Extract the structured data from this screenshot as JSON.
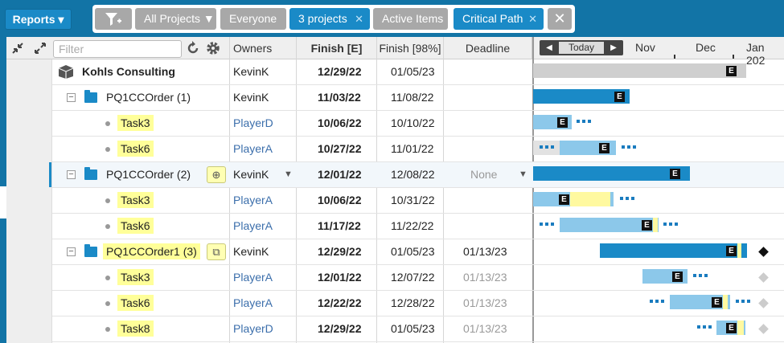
{
  "topbar": {
    "reports_label": "Reports ▾",
    "chips": {
      "all_projects": "All Projects ▼",
      "everyone": "Everyone",
      "three_projects": "3 projects",
      "active_items": "Active Items",
      "critical_path": "Critical Path",
      "close_x": "✕",
      "clear": "✕"
    }
  },
  "header": {
    "filter_placeholder": "Filter",
    "columns": {
      "owners": "Owners",
      "finish_e": "Finish [E]",
      "finish_98": "Finish [98%]",
      "deadline": "Deadline"
    },
    "gantt": {
      "prev": "◀",
      "today": "Today",
      "next": "▶",
      "months": [
        "Nov",
        "Dec",
        "Jan 202"
      ]
    }
  },
  "rows": [
    {
      "name": "Kohls Consulting",
      "owner": "KevinK",
      "finish_e": "12/29/22",
      "finish_98": "01/05/23",
      "deadline": ""
    },
    {
      "name": "PQ1CCOrder (1)",
      "owner": "KevinK",
      "finish_e": "11/03/22",
      "finish_98": "11/08/22",
      "deadline": ""
    },
    {
      "name": "Task3",
      "owner": "PlayerD",
      "finish_e": "10/06/22",
      "finish_98": "10/10/22",
      "deadline": ""
    },
    {
      "name": "Task6",
      "owner": "PlayerA",
      "finish_e": "10/27/22",
      "finish_98": "11/01/22",
      "deadline": ""
    },
    {
      "name": "PQ1CCOrder (2)",
      "owner": "KevinK",
      "finish_e": "12/01/22",
      "finish_98": "12/08/22",
      "deadline": "None"
    },
    {
      "name": "Task3",
      "owner": "PlayerA",
      "finish_e": "10/06/22",
      "finish_98": "10/31/22",
      "deadline": ""
    },
    {
      "name": "Task6",
      "owner": "PlayerA",
      "finish_e": "11/17/22",
      "finish_98": "11/22/22",
      "deadline": ""
    },
    {
      "name": "PQ1CCOrder1 (3)",
      "owner": "KevinK",
      "finish_e": "12/29/22",
      "finish_98": "01/05/23",
      "deadline": "01/13/23"
    },
    {
      "name": "Task3",
      "owner": "PlayerA",
      "finish_e": "12/01/22",
      "finish_98": "12/07/22",
      "deadline": "01/13/23"
    },
    {
      "name": "Task6",
      "owner": "PlayerA",
      "finish_e": "12/22/22",
      "finish_98": "12/28/22",
      "deadline": "01/13/23"
    },
    {
      "name": "Task8",
      "owner": "PlayerD",
      "finish_e": "12/29/22",
      "finish_98": "01/05/23",
      "deadline": "01/13/23"
    }
  ],
  "gantt_marker_label": "E",
  "colors": {
    "topbar": "#1274a6",
    "accent": "#1a8ac7",
    "light_bar": "#8cc8ea",
    "highlight": "#ffff99",
    "owner_link": "#3b6eab"
  }
}
